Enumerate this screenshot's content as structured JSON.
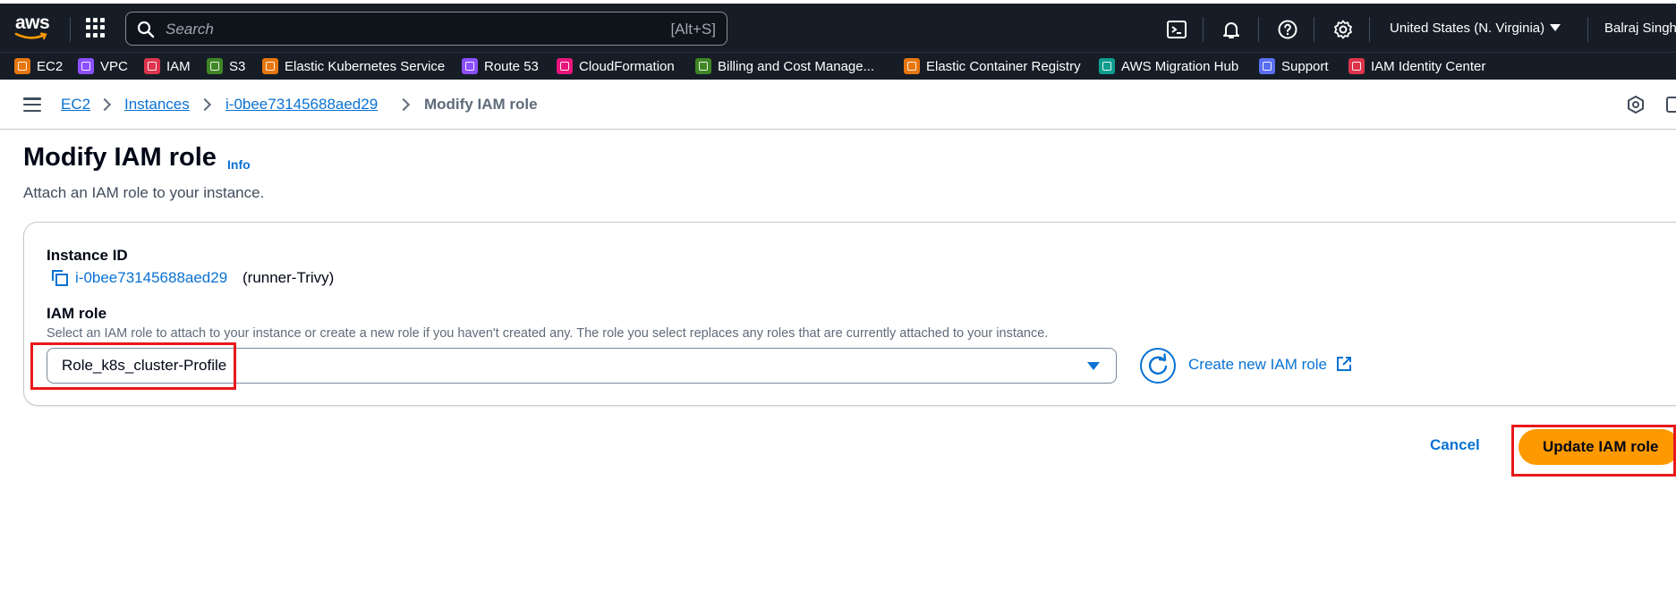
{
  "topnav": {
    "logo_text": "aws",
    "search_placeholder": "Search",
    "search_shortcut": "[Alt+S]",
    "region": "United States (N. Virginia)",
    "user": "Balraj Singh"
  },
  "favorites": [
    {
      "label": "EC2",
      "color": "#e7760f"
    },
    {
      "label": "VPC",
      "color": "#8c4fff"
    },
    {
      "label": "IAM",
      "color": "#dd344c"
    },
    {
      "label": "S3",
      "color": "#3f8624"
    },
    {
      "label": "Elastic Kubernetes Service",
      "color": "#e7760f"
    },
    {
      "label": "Route 53",
      "color": "#8c4fff"
    },
    {
      "label": "CloudFormation",
      "color": "#e7157b"
    },
    {
      "label": "Billing and Cost Manage...",
      "color": "#3f8624"
    },
    {
      "label": "Elastic Container Registry",
      "color": "#e7760f"
    },
    {
      "label": "AWS Migration Hub",
      "color": "#0f9d8e"
    },
    {
      "label": "Support",
      "color": "#5a6ff0"
    },
    {
      "label": "IAM Identity Center",
      "color": "#dd344c"
    }
  ],
  "breadcrumb": {
    "items": [
      "EC2",
      "Instances",
      "i-0bee73145688aed29"
    ],
    "current": "Modify IAM role"
  },
  "page": {
    "title": "Modify IAM role",
    "info": "Info",
    "description": "Attach an IAM role to your instance."
  },
  "form": {
    "instance_id_label": "Instance ID",
    "instance_id": "i-0bee73145688aed29",
    "instance_name": "(runner-Trivy)",
    "iam_role_label": "IAM role",
    "iam_role_hint": "Select an IAM role to attach to your instance or create a new role if you haven't created any. The role you select replaces any roles that are currently attached to your instance.",
    "iam_role_value": "Role_k8s_cluster-Profile",
    "create_role_link": "Create new IAM role"
  },
  "actions": {
    "cancel": "Cancel",
    "submit": "Update IAM role"
  },
  "colors": {
    "nav_bg": "#161d26",
    "link": "#0972d3",
    "primary": "#ff9900",
    "annotation": "#e8181b"
  }
}
